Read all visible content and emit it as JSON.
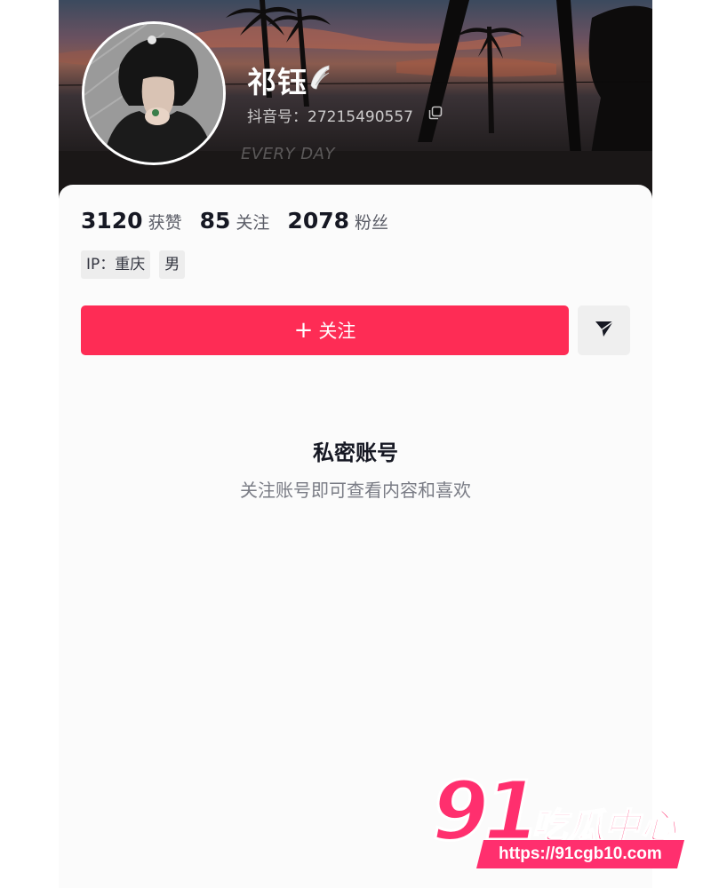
{
  "profile": {
    "nickname": "祁钰",
    "douyin_id": "抖音号：27215490557",
    "banner_text": "EVERY DAY"
  },
  "stats": {
    "likes": {
      "value": "3120",
      "label": "获赞"
    },
    "following": {
      "value": "85",
      "label": "关注"
    },
    "followers": {
      "value": "2078",
      "label": "粉丝"
    }
  },
  "tags": [
    "IP：重庆",
    "男"
  ],
  "actions": {
    "follow_plus": "+",
    "follow_label": "关注",
    "share_icon": "send-icon"
  },
  "private_notice": {
    "title": "私密账号",
    "subtitle": "关注账号即可查看内容和喜欢"
  },
  "watermark": {
    "logo_number": "91",
    "logo_name": "吃瓜中心",
    "url": "https://91cgb10.com"
  },
  "colors": {
    "accent": "#fe2c55",
    "watermark": "#ff2f6e"
  }
}
